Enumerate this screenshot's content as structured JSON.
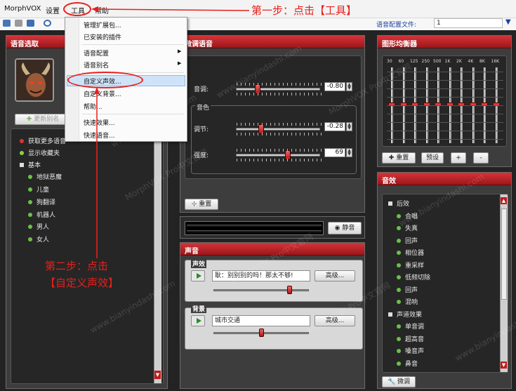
{
  "menubar": {
    "app": "MorphVOX",
    "settings": "设置",
    "tools": "工具",
    "help": "帮助"
  },
  "toolbar": {
    "voice_config_label": "语音配置文件:",
    "voice_config_value": "1"
  },
  "tools_menu": {
    "items": [
      "管理扩展包...",
      "已安装的插件",
      "语音配置",
      "语音别名",
      "自定义声效...",
      "自定义背景...",
      "帮助...",
      "快速效果...",
      "快速语音..."
    ]
  },
  "voice_select": {
    "title": "语音选取",
    "update_alias": "更新别名",
    "items": [
      "获取更多语音",
      "显示收藏夹",
      "基本",
      "地狱恶魔",
      "儿童",
      "狗翻译",
      "机器人",
      "男人",
      "女人"
    ]
  },
  "tweak": {
    "title": "微调语音",
    "pitch_label": "音调:",
    "pitch_value": "-0.80",
    "timbre_group": "音色",
    "adjust_label": "调节:",
    "adjust_value": "-0.28",
    "strength_label": "强度:",
    "strength_value": "69",
    "reset_button": "重置",
    "pitch_pos": 0.25,
    "adjust_pos": 0.3,
    "strength_pos": 0.62
  },
  "mute_button": "静音",
  "sound": {
    "title": "声音",
    "effects_group": "声效",
    "effect_value": "耿：别别别的吗！那太不够!",
    "advanced1": "高级...",
    "background_group": "背景",
    "background_value": "城市交通",
    "advanced2": "高级...",
    "effect_vol": 0.8,
    "bg_vol": 0.5
  },
  "eq": {
    "title": "图形均衡器",
    "bands": [
      "30",
      "60",
      "125",
      "250",
      "500",
      "1K",
      "2K",
      "4K",
      "8K",
      "16K"
    ],
    "reset": "重置",
    "preset": "预设",
    "plus": "+",
    "minus": "-"
  },
  "effects": {
    "title": "音效",
    "items": [
      "后效",
      "合唱",
      "失真",
      "回声",
      "相位器",
      "重采样",
      "低频切除",
      "回声",
      "混响",
      "声道效果",
      "单音调",
      "超高音",
      "嗓音声",
      "鼻音"
    ],
    "tweak_button": "微调"
  },
  "annotations": {
    "step1": "第一步：点击【工具】",
    "step2_line1": "第二步：点击",
    "step2_line2": "【自定义声效】"
  },
  "watermarks": [
    "www.bianyindashi.com",
    "MorphVOX Pro中文官网",
    "www.bianyindashi.com",
    "MorphVOX Pro中文官网",
    "www.bianyindashi.com",
    "MorphVOX Pro中文官网",
    "www.bianyindashi.com",
    "MorphVOX Pro中文官网",
    "www.bianyindashi.com"
  ],
  "colors": {
    "title_red": "#c0262b",
    "annotation_red": "#e8201c",
    "panel_dark": "#3d3d3d"
  }
}
